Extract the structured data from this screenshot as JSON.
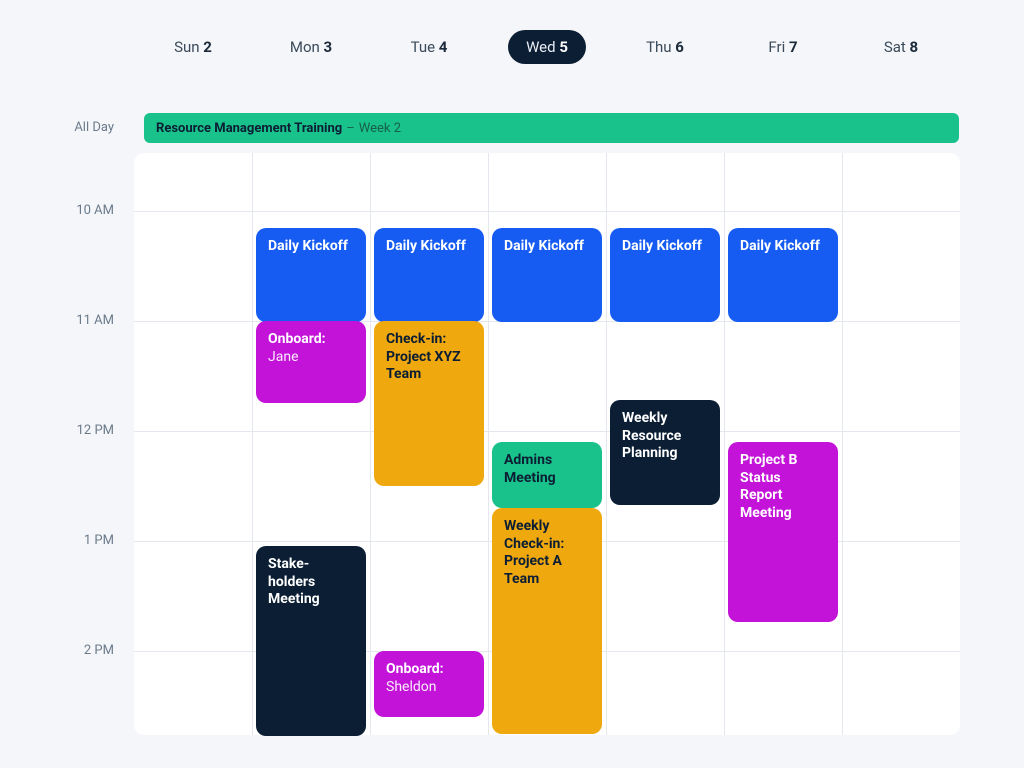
{
  "header": {
    "days": [
      {
        "dow": "Sun",
        "num": "2",
        "selected": false
      },
      {
        "dow": "Mon",
        "num": "3",
        "selected": false
      },
      {
        "dow": "Tue",
        "num": "4",
        "selected": false
      },
      {
        "dow": "Wed",
        "num": "5",
        "selected": true
      },
      {
        "dow": "Thu",
        "num": "6",
        "selected": false
      },
      {
        "dow": "Fri",
        "num": "7",
        "selected": false
      },
      {
        "dow": "Sat",
        "num": "8",
        "selected": false
      }
    ]
  },
  "time_labels": {
    "all_day": "All Day",
    "t10": "10 AM",
    "t11": "11 AM",
    "t12": "12 PM",
    "t1": "1 PM",
    "t2": "2 PM"
  },
  "allday": {
    "title_bold": "Resource Management Training",
    "sep": "–",
    "title_rest": "Week 2"
  },
  "events": {
    "kickoff_mon": "Daily Kickoff",
    "kickoff_tue": "Daily Kickoff",
    "kickoff_wed": "Daily Kickoff",
    "kickoff_thu": "Daily Kickoff",
    "kickoff_fri": "Daily Kickoff",
    "onboard_jane_label": "Onboard:",
    "onboard_jane_name": "Jane",
    "checkin_xyz": "Check-in: Project XYZ Team",
    "stakeholders": "Stake-holders Meeting",
    "onboard_sheldon_label": "Onboard:",
    "onboard_sheldon_name": "Sheldon",
    "admins_meeting": "Admins Meeting",
    "weekly_checkin_a": "Weekly Check-in: Project A Team",
    "weekly_resource_planning": "Weekly Resource Planning",
    "project_b_status": "Project B Status Report Meeting"
  },
  "colors": {
    "blue": "#165cf3",
    "magenta": "#c313d9",
    "orange": "#f0a80f",
    "teal": "#19c28a",
    "dark": "#0b1e34",
    "grid_bg": "#ffffff",
    "page_bg": "#f4f6f9",
    "grid_line": "#e4e8ee",
    "wed_highlight": "#dfe3e8"
  }
}
